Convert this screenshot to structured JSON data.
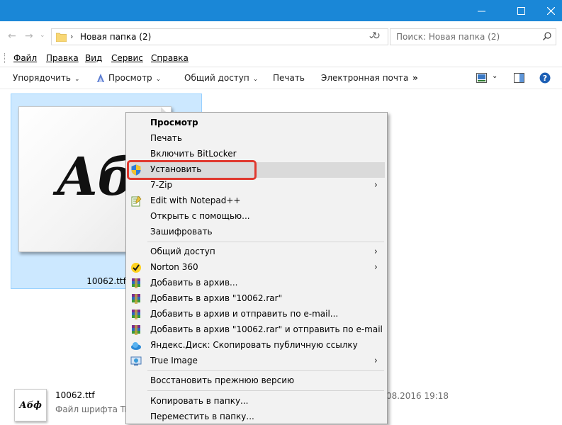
{
  "window": {
    "minimize_icon": "minimize-icon",
    "maximize_icon": "maximize-icon",
    "close_icon": "close-icon"
  },
  "address": {
    "path": "Новая папка (2)",
    "search_placeholder": "Поиск: Новая папка (2)"
  },
  "menubar": [
    "Файл",
    "Правка",
    "Вид",
    "Сервис",
    "Справка"
  ],
  "toolbar": {
    "organize": "Упорядочить",
    "preview": "Просмотр",
    "share": "Общий доступ",
    "print": "Печать",
    "email": "Электронная почта",
    "more": "»"
  },
  "file": {
    "name": "10062.ttf",
    "thumb_text": "Абф",
    "detail_name": "10062.ttf",
    "detail_type": "Файл шрифта Tru",
    "detail_date": "08.2016 19:18",
    "detail_icon_text": "Абф"
  },
  "context_menu": {
    "items": [
      {
        "label": "Просмотр"
      },
      {
        "label": "Печать"
      },
      {
        "label": "Включить BitLocker"
      },
      {
        "label": "Установить"
      },
      {
        "label": "7-Zip"
      },
      {
        "label": "Edit with Notepad++"
      },
      {
        "label": "Открыть с помощью..."
      },
      {
        "label": "Зашифровать"
      },
      {
        "label": "Общий доступ"
      },
      {
        "label": "Norton 360"
      },
      {
        "label": "Добавить в архив..."
      },
      {
        "label": "Добавить в архив \"10062.rar\""
      },
      {
        "label": "Добавить в архив и отправить по e-mail..."
      },
      {
        "label": "Добавить в архив \"10062.rar\" и отправить по e-mail"
      },
      {
        "label": "Яндекс.Диск: Скопировать публичную ссылку"
      },
      {
        "label": "True Image"
      },
      {
        "label": "Восстановить прежнюю версию"
      },
      {
        "label": "Копировать в папку..."
      },
      {
        "label": "Переместить в папку..."
      }
    ]
  },
  "colors": {
    "titlebar": "#1a87d7",
    "selection": "#cce8ff",
    "menu_highlight": "#dadada",
    "annotation": "#e0392f"
  }
}
